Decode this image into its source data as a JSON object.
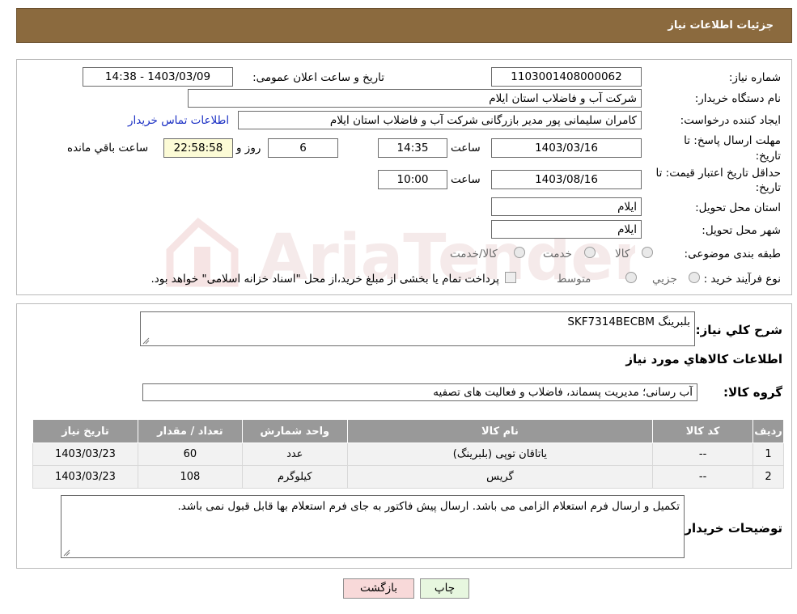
{
  "header": {
    "title": "جزئیات اطلاعات نیاز"
  },
  "form": {
    "need_number_label": "شماره نیاز:",
    "need_number": "1103001408000062",
    "announce_label": "تاریخ و ساعت اعلان عمومی:",
    "announce_value": "1403/03/09 - 14:38",
    "buyer_org_label": "نام دستگاه خریدار:",
    "buyer_org": "شرکت آب و فاضلاب استان ایلام",
    "creator_label": "ایجاد کننده درخواست:",
    "creator": "کامران سلیمانی پور مدیر بازرگانی شرکت آب و فاضلاب استان ایلام",
    "contact_link": "اطلاعات تماس خریدار",
    "deadline_label_1": "مهلت ارسال پاسخ: تا",
    "deadline_label_2": "تاریخ:",
    "deadline_date": "1403/03/16",
    "time_label": "ساعت",
    "deadline_time": "14:35",
    "days_value": "6",
    "days_label": "روز و",
    "remaining_value": "22:58:58",
    "remaining_label": "ساعت باقي مانده",
    "validity_label_1": "حداقل تاریخ اعتبار قیمت: تا",
    "validity_label_2": "تاریخ:",
    "validity_date": "1403/08/16",
    "validity_time_label": "ساعت",
    "validity_time": "10:00",
    "province_label": "استان محل تحویل:",
    "province": "ایلام",
    "city_label": "شهر محل تحویل:",
    "city": "ایلام",
    "category_label": "طبقه بندی موضوعی:",
    "category_options": [
      "کالا",
      "خدمت",
      "کالا/خدمت"
    ],
    "process_label": "نوع فرآیند خرید :",
    "process_options": [
      "جزیي",
      "متوسط"
    ],
    "payment_note": "پرداخت تمام یا بخشی از مبلغ خرید،از محل \"اسناد خزانه اسلامی\" خواهد بود."
  },
  "details": {
    "summary_label": "شرح كلي نياز:",
    "summary": "بلبرینگ SKF7314BECBM",
    "goods_info_title": "اطلاعات کالاهاي مورد نياز",
    "group_label": "گروه کالا:",
    "group_value": "آب رسانی؛ مدیریت پسماند، فاضلاب و فعالیت های تصفیه",
    "table": {
      "headers": [
        "رديف",
        "کد کالا",
        "نام کالا",
        "واحد شمارش",
        "تعداد / مقدار",
        "تاريخ نياز"
      ],
      "rows": [
        [
          "1",
          "--",
          "یاتاقان توپی (بلبرینگ)",
          "عدد",
          "60",
          "1403/03/23"
        ],
        [
          "2",
          "--",
          "گریس",
          "کیلوگرم",
          "108",
          "1403/03/23"
        ]
      ]
    },
    "notes_label": "توضیحات خریدار:",
    "notes": "تکمیل و ارسال فرم استعلام الزامی می باشد. ارسال پیش فاکتور به جای فرم استعلام بها قابل قبول نمی باشد."
  },
  "buttons": {
    "print": "چاپ",
    "back": "بازگشت"
  },
  "watermark": {
    "text": "AriaTender.neT"
  },
  "colors": {
    "header_bg": "#8b6a3e",
    "link": "#1a2fc4",
    "table_header": "#999999",
    "back_button": "#f8d9d9",
    "print_button": "#e7f7df"
  }
}
